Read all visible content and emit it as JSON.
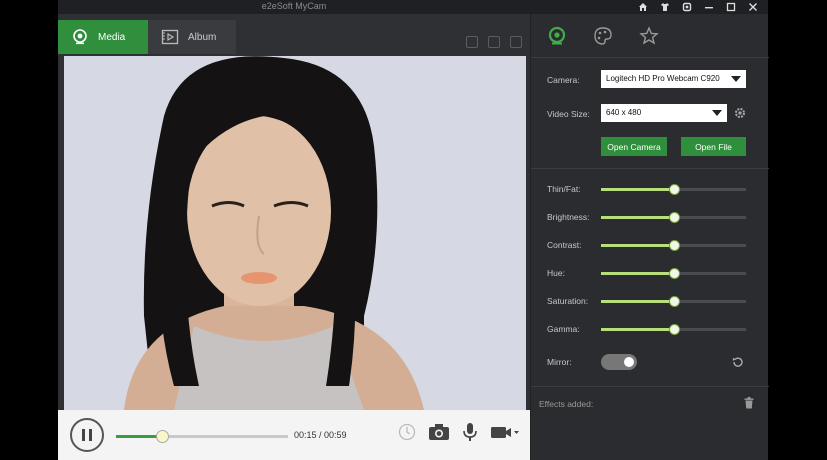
{
  "window": {
    "title": "e2eSoft MyCam",
    "controls": [
      "home-icon",
      "shirt-icon",
      "settings-icon",
      "minimize-icon",
      "maximize-icon",
      "close-icon"
    ]
  },
  "tabs": [
    {
      "label": "Media",
      "icon": "webcam-icon",
      "active": true
    },
    {
      "label": "Album",
      "icon": "album-icon",
      "active": false
    }
  ],
  "player": {
    "time": "00:15 / 00:59",
    "progress": 0.27,
    "icons": [
      "clock-icon",
      "camera-icon",
      "microphone-icon",
      "video-camera-icon"
    ]
  },
  "panel": {
    "tabs": [
      "webcam-icon",
      "palette-icon",
      "star-icon"
    ],
    "camera_label": "Camera:",
    "camera_value": "Logitech HD Pro Webcam C920",
    "video_size_label": "Video Size:",
    "video_size_value": "640 x 480",
    "open_camera": "Open Camera",
    "open_file": "Open File",
    "sliders": [
      {
        "label": "Thin/Fat:",
        "value": 0.5
      },
      {
        "label": "Brightness:",
        "value": 0.5
      },
      {
        "label": "Contrast:",
        "value": 0.5
      },
      {
        "label": "Hue:",
        "value": 0.5
      },
      {
        "label": "Saturation:",
        "value": 0.5
      },
      {
        "label": "Gamma:",
        "value": 0.5
      }
    ],
    "mirror_label": "Mirror:",
    "mirror_on": true,
    "effects_label": "Effects added:"
  },
  "colors": {
    "accent": "#2f8f3c",
    "slider_fill": "#b7e07a",
    "panel_bg": "#2b2c2f"
  }
}
